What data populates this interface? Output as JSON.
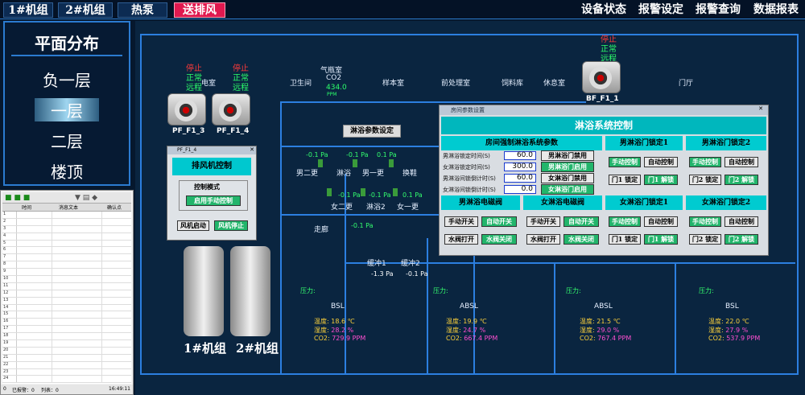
{
  "topbar": {
    "tabs": [
      "1#机组",
      "2#机组",
      "热泵",
      "送排风"
    ],
    "right": [
      "设备状态",
      "报警设定",
      "报警查询",
      "数据报表"
    ]
  },
  "leftnav": {
    "items": [
      "平面分布",
      "负一层",
      "一层",
      "二层",
      "楼顶"
    ]
  },
  "log": {
    "cols": [
      "时间",
      "消息文本",
      "确认点"
    ],
    "status": [
      "0",
      "已报警：0",
      "列表：0",
      "16:49:11"
    ],
    "rows": [
      "1",
      "2",
      "3",
      "4",
      "5",
      "6",
      "7",
      "8",
      "9",
      "10",
      "11",
      "12",
      "13",
      "14",
      "15",
      "16",
      "17",
      "18",
      "19",
      "20",
      "21",
      "22",
      "23",
      "24"
    ]
  },
  "rooms": {
    "power": "电室",
    "wc": "卫生间",
    "gas": "气瓶室",
    "co2_label": "CO2",
    "co2_val": "434.0",
    "co2_unit": "PPM",
    "sample": "样本室",
    "pre": "前处理室",
    "feed": "饲料库",
    "rest": "休息室",
    "hall": "门厅",
    "bath": "淋浴",
    "m2": "男二更",
    "m1": "男一更",
    "wash": "换鞋",
    "f2": "女二更",
    "bath2": "淋浴2",
    "f1": "女一更",
    "corridor": "走廊",
    "buf1": "缓冲1",
    "buf2": "缓冲2",
    "bsl1": "BSL",
    "absl1": "ABSL",
    "absl2": "ABSL",
    "bsl2": "BSL"
  },
  "fans": {
    "f3": {
      "name": "PF_F1_3",
      "s1": "停止",
      "s2": "正常",
      "s3": "远程"
    },
    "f4": {
      "name": "PF_F1_4",
      "s1": "停止",
      "s2": "正常",
      "s3": "远程"
    },
    "f1": {
      "name": "BF_F1_1",
      "s1": "停止",
      "s2": "正常",
      "s3": "远程"
    }
  },
  "pressures": {
    "p1": "-0.1",
    "p2": "-0.1",
    "p3": "0.1",
    "p4": "-0.1",
    "p5": "-0.1",
    "p6": "0.1",
    "p7": "-0.1",
    "p8": "-0.1",
    "p9": "-1.3",
    "p10": "-0.1",
    "unit": "Pa"
  },
  "pressure_label": "压力:",
  "envs": [
    {
      "t": "18.6",
      "h": "28.2",
      "c": "729.9"
    },
    {
      "t": "19.9",
      "h": "24.7",
      "c": "667.4"
    },
    {
      "t": "21.5",
      "h": "29.0",
      "c": "767.4"
    },
    {
      "t": "22.0",
      "h": "27.9",
      "c": "537.9"
    }
  ],
  "env_labels": {
    "temp": "温度:",
    "hum": "湿度:",
    "co2": "CO2:",
    "tu": "℃",
    "hu": "%",
    "cu": "PPM"
  },
  "paramBtn": "淋浴参数设定",
  "fandlg": {
    "title": "PF_F1_4",
    "heading": "排风机控制",
    "mode": "控制模式",
    "modeBtn": "启用手动控制",
    "start": "风机启动",
    "stop": "风机停止"
  },
  "units": {
    "u1": "1#机组",
    "u2": "2#机组"
  },
  "dlg": {
    "title": "房间参数设置",
    "header": "淋浴系统控制",
    "paramTitle": "房间强制淋浴系统参数",
    "p1l": "男淋浴锁定时间(S)",
    "p1v": "60.0",
    "p2l": "女淋浴锁定时间(S)",
    "p2v": "300.0",
    "p3l": "男淋浴间锁倒计时(S)",
    "p3v": "60.0",
    "p4l": "女淋浴间锁倒计时(S)",
    "p4v": "0.0",
    "b1": "男淋浴门禁用",
    "b2": "男淋浴门启用",
    "b3": "女淋浴门禁用",
    "b4": "女淋浴门启用",
    "lock1": "男淋浴门锁定1",
    "lock2": "男淋浴门锁定2",
    "lock3": "女淋浴门锁定1",
    "lock4": "女淋浴门锁定2",
    "manual": "手动控制",
    "auto": "自动控制",
    "doorLock": "门1 锁定",
    "doorUnlock": "门1 解锁",
    "door2Lock": "门2 锁定",
    "door2Unlock": "门2 解锁",
    "valveM": "男淋浴电磁阀",
    "valveF": "女淋浴电磁阀",
    "mOpen": "手动开关",
    "aOpen": "自动开关",
    "wOpen": "水阀打开",
    "wClose": "水阀关闭"
  }
}
